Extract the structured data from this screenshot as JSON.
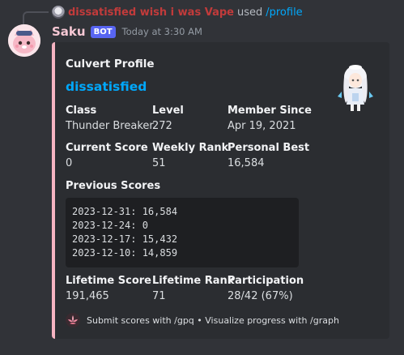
{
  "reply": {
    "username": "dissatisfied wish i was Vape",
    "action": "used",
    "command": "/profile"
  },
  "message": {
    "author": "Saku",
    "bot_tag": "BOT",
    "timestamp": "Today at 3:30 AM"
  },
  "embed": {
    "accent_color": "#f5b3c1",
    "title": "Culvert Profile",
    "character_name": "dissatisfied",
    "fields": {
      "class": {
        "name": "Class",
        "value": "Thunder Breaker"
      },
      "level": {
        "name": "Level",
        "value": "272"
      },
      "member_since": {
        "name": "Member Since",
        "value": "Apr 19, 2021"
      },
      "current_score": {
        "name": "Current Score",
        "value": "0"
      },
      "weekly_rank": {
        "name": "Weekly Rank",
        "value": "51"
      },
      "personal_best": {
        "name": "Personal Best",
        "value": "16,584"
      },
      "lifetime_score": {
        "name": "Lifetime Score",
        "value": "191,465"
      },
      "lifetime_rank": {
        "name": "Lifetime Rank",
        "value": "71"
      },
      "participation": {
        "name": "Participation",
        "value": "28/42 (67%)"
      }
    },
    "previous_scores": {
      "label": "Previous Scores",
      "lines": [
        "2023-12-31: 16,584",
        "2023-12-24: 0",
        "2023-12-17: 15,432",
        "2023-12-10: 14,859"
      ]
    },
    "footer": "Submit scores with /gpq • Visualize progress with /graph"
  }
}
